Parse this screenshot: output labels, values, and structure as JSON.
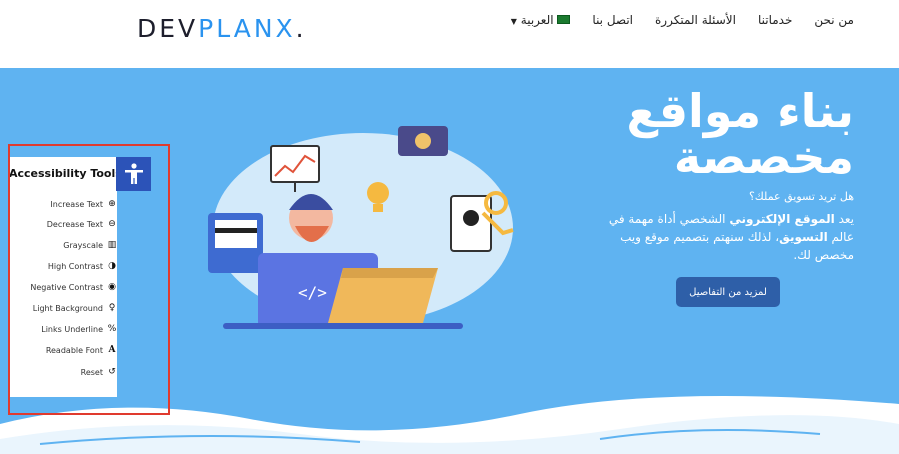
{
  "header": {
    "logo_part1": "DEV",
    "logo_part2": "PLANX",
    "logo_dot": ".",
    "nav": [
      {
        "label": "من نحن"
      },
      {
        "label": "خدماتنا"
      },
      {
        "label": "الأسئلة المتكررة"
      },
      {
        "label": "اتصل بنا"
      }
    ],
    "language_label": "العربية"
  },
  "hero": {
    "title_line1": "بناء مواقع",
    "title_line2": "مخصصة",
    "question": "هل تريد تسويق عملك؟",
    "desc_part1": "يعد ",
    "desc_bold1": "الموقع الإلكتروني",
    "desc_part2": " الشخصي أداة مهمة في عالم ",
    "desc_bold2": "التسويق",
    "desc_part3": "، لذلك سنهتم بتصميم موقع ويب مخصص لك.",
    "cta_label": "لمزيد من التفاصيل"
  },
  "accessibility": {
    "title": "Accessibility Tools",
    "tools": [
      {
        "label": "Increase Text",
        "icon": "zoom-in-icon"
      },
      {
        "label": "Decrease Text",
        "icon": "zoom-out-icon"
      },
      {
        "label": "Grayscale",
        "icon": "grayscale-icon"
      },
      {
        "label": "High Contrast",
        "icon": "contrast-icon"
      },
      {
        "label": "Negative Contrast",
        "icon": "eye-icon"
      },
      {
        "label": "Light Background",
        "icon": "lightbulb-icon"
      },
      {
        "label": "Links Underline",
        "icon": "link-icon"
      },
      {
        "label": "Readable Font",
        "icon": "font-icon"
      },
      {
        "label": "Reset",
        "icon": "reset-icon"
      }
    ]
  },
  "colors": {
    "hero_bg": "#5fb3f1",
    "cta_bg": "#2e5fa8",
    "accessibility_button": "#2c53b8",
    "highlight_border": "#e03a2e",
    "logo_accent": "#2a93ef"
  }
}
